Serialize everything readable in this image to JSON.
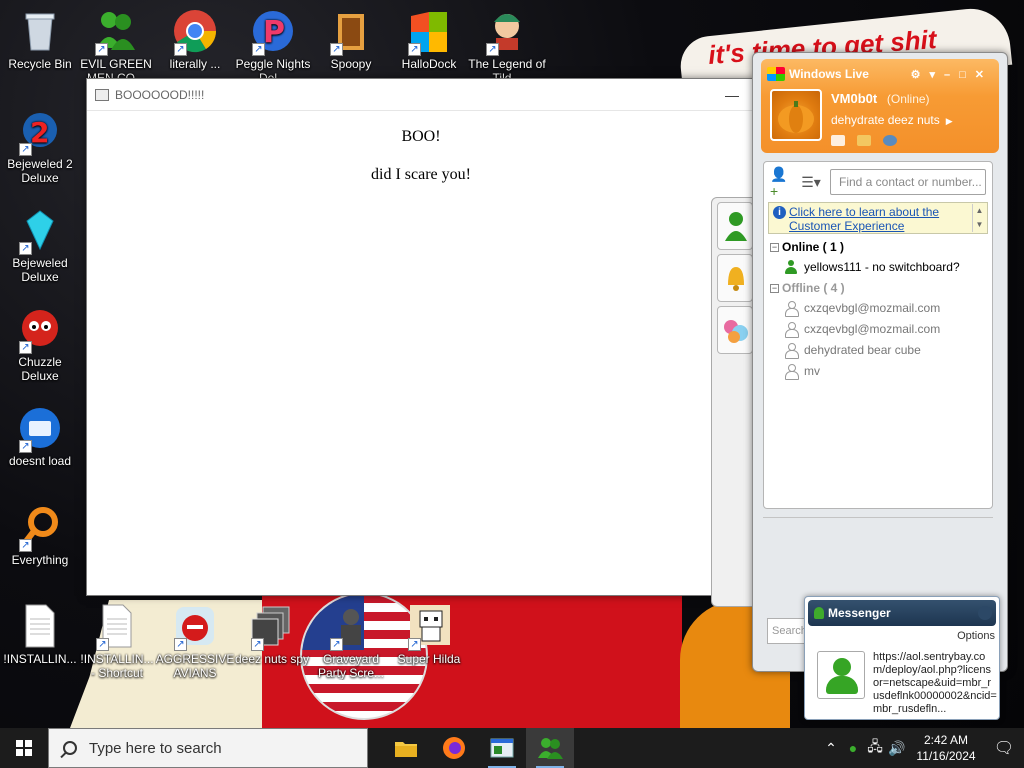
{
  "desktop": {
    "wallpaper_text": "it's time to get shit",
    "icons": [
      {
        "label": "Recycle Bin",
        "name": "recycle-bin-icon"
      },
      {
        "label": "EVIL GREEN MEN CO...",
        "name": "evil-green-men-icon"
      },
      {
        "label": "literally ...",
        "name": "chrome-icon"
      },
      {
        "label": "Peggle Nights Del...",
        "name": "peggle-nights-icon"
      },
      {
        "label": "Spoopy",
        "name": "spoopy-icon"
      },
      {
        "label": "HalloDock",
        "name": "hallodock-icon"
      },
      {
        "label": "The Legend of Tild...",
        "name": "legend-icon"
      },
      {
        "label": "Bejeweled 2 Deluxe",
        "name": "bejeweled2-icon"
      },
      {
        "label": "Bejeweled Deluxe",
        "name": "bejeweled-icon"
      },
      {
        "label": "Chuzzle Deluxe",
        "name": "chuzzle-icon"
      },
      {
        "label": "doesnt load",
        "name": "thunderbird-icon"
      },
      {
        "label": "Everything",
        "name": "everything-icon"
      },
      {
        "label": "!INSTALLIN...",
        "name": "install-file-icon"
      },
      {
        "label": "!INSTALLIN... - Shortcut",
        "name": "install-shortcut-icon"
      },
      {
        "label": "AGGRESSIVE AVIANS",
        "name": "angry-birds-icon"
      },
      {
        "label": "deez nuts spy",
        "name": "deez-nuts-spy-icon"
      },
      {
        "label": "Graveyard Party Scre...",
        "name": "graveyard-icon"
      },
      {
        "label": "Super Hilda",
        "name": "super-hilda-icon"
      }
    ]
  },
  "boo_window": {
    "title": "BOOOOOOD!!!!!",
    "minimize": "—",
    "heading": "BOO!",
    "text": "did I scare you!"
  },
  "messenger": {
    "title": "Windows Live",
    "username": "VM0b0t",
    "status": "(Online)",
    "personal_message": "dehydrate deez nuts",
    "search_placeholder": "Find a contact or number...",
    "banner_link": "Click here to learn about the Customer Experience",
    "online_group": "Online ( 1 )",
    "offline_group": "Offline ( 4 )",
    "online_contacts": [
      "yellows111 - no switchboard?"
    ],
    "offline_contacts": [
      "cxzqevbgl@mozmail.com",
      "cxzqevbgl@mozmail.com",
      "dehydrated bear cube",
      "mv"
    ],
    "search_bottom": "Search"
  },
  "toast": {
    "title": "Messenger",
    "options": "Options",
    "message": "https://aol.sentrybay.com/deploy/aol.php?licensor=netscape&uid=mbr_rusdeflnk00000002&ncid=mbr_rusdefln..."
  },
  "taskbar": {
    "search_placeholder": "Type here to search",
    "time": "2:42 AM",
    "date": "11/16/2024"
  },
  "colors": {
    "wlm_orange": "#f79b34",
    "online_green": "#2f9a24",
    "taskbar": "#1c1c1c"
  }
}
